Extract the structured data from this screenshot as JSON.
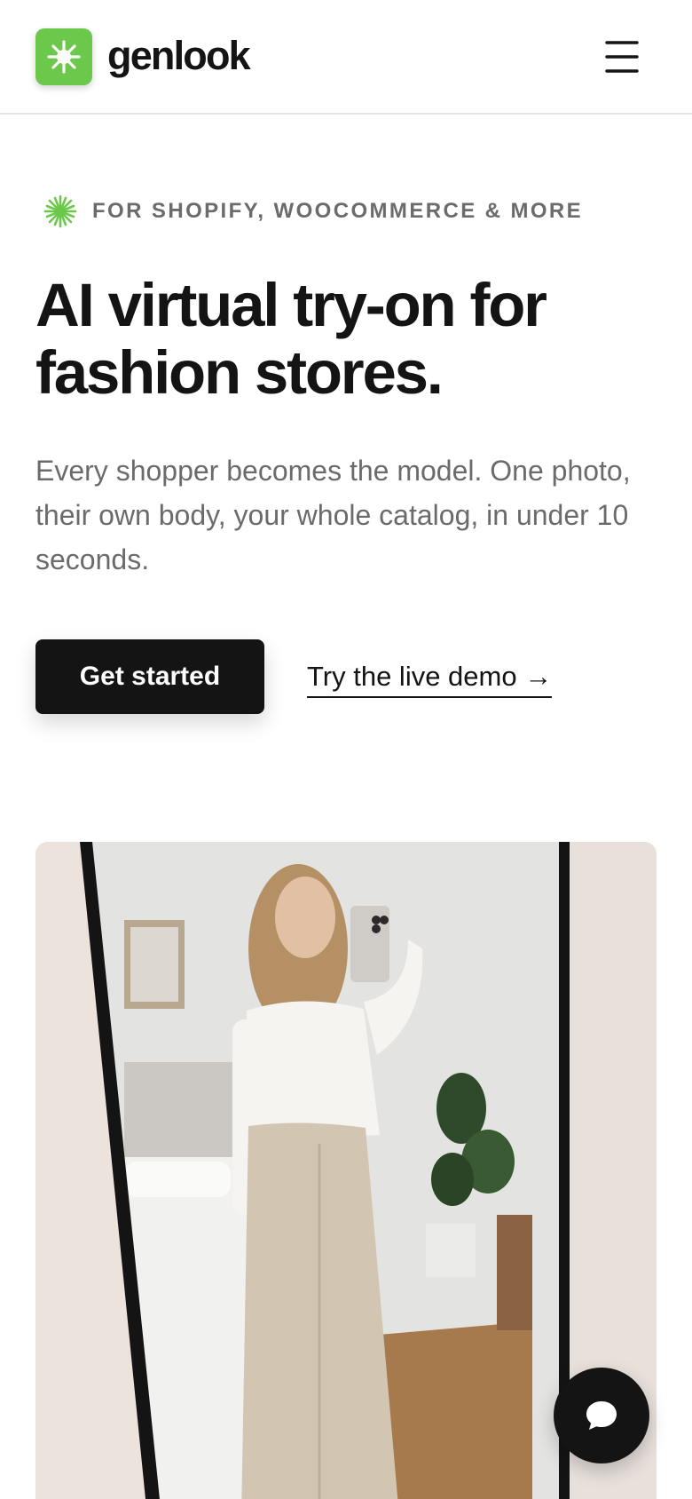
{
  "header": {
    "brand_name": "genlook",
    "brand_color": "#6cc84a",
    "logo_icon": "sparkle-icon",
    "menu_icon": "hamburger-menu-icon"
  },
  "hero": {
    "eyebrow_icon": "sparkle-icon",
    "eyebrow_text": "FOR SHOPIFY, WOOCOMMERCE & MORE",
    "headline_line1": "AI virtual try-on for",
    "headline_line2": "fashion stores.",
    "subtext": "Every shopper becomes the model. One photo, their own body, your whole catalog, in under 10 seconds.",
    "primary_cta": "Get started",
    "secondary_cta": "Try the live demo →"
  },
  "chat": {
    "icon": "chat-bubble-icon"
  }
}
